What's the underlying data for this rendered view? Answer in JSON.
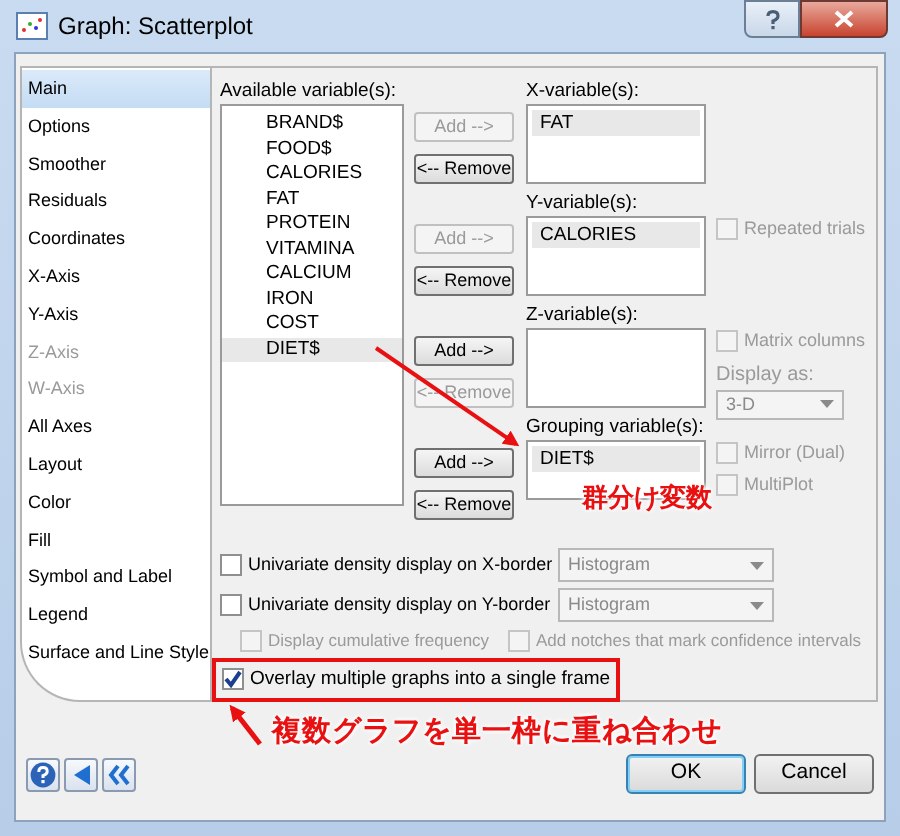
{
  "window": {
    "title": "Graph: Scatterplot"
  },
  "sidebar": {
    "items": [
      {
        "label": "Main",
        "selected": true,
        "disabled": false
      },
      {
        "label": "Options",
        "selected": false,
        "disabled": false
      },
      {
        "label": "Smoother",
        "selected": false,
        "disabled": false
      },
      {
        "label": "Residuals",
        "selected": false,
        "disabled": false
      },
      {
        "label": "Coordinates",
        "selected": false,
        "disabled": false
      },
      {
        "label": "X-Axis",
        "selected": false,
        "disabled": false
      },
      {
        "label": "Y-Axis",
        "selected": false,
        "disabled": false
      },
      {
        "label": "Z-Axis",
        "selected": false,
        "disabled": true
      },
      {
        "label": "W-Axis",
        "selected": false,
        "disabled": true
      },
      {
        "label": "All Axes",
        "selected": false,
        "disabled": false
      },
      {
        "label": "Layout",
        "selected": false,
        "disabled": false
      },
      {
        "label": "Color",
        "selected": false,
        "disabled": false
      },
      {
        "label": "Fill",
        "selected": false,
        "disabled": false
      },
      {
        "label": "Symbol and Label",
        "selected": false,
        "disabled": false
      },
      {
        "label": "Legend",
        "selected": false,
        "disabled": false
      },
      {
        "label": "Surface and Line Style",
        "selected": false,
        "disabled": false
      }
    ]
  },
  "available": {
    "label": "Available variable(s):",
    "items": [
      {
        "label": "BRAND$",
        "selected": false
      },
      {
        "label": "FOOD$",
        "selected": false
      },
      {
        "label": "CALORIES",
        "selected": false
      },
      {
        "label": "FAT",
        "selected": false
      },
      {
        "label": "PROTEIN",
        "selected": false
      },
      {
        "label": "VITAMINA",
        "selected": false
      },
      {
        "label": "CALCIUM",
        "selected": false
      },
      {
        "label": "IRON",
        "selected": false
      },
      {
        "label": "COST",
        "selected": false
      },
      {
        "label": "DIET$",
        "selected": true
      }
    ]
  },
  "variable_groups": [
    {
      "label": "X-variable(s):",
      "values": [
        "FAT"
      ],
      "add_button": {
        "label": "Add -->",
        "disabled": true
      },
      "remove_button": {
        "label": "<-- Remove",
        "disabled": false
      }
    },
    {
      "label": "Y-variable(s):",
      "values": [
        "CALORIES"
      ],
      "add_button": {
        "label": "Add -->",
        "disabled": true
      },
      "remove_button": {
        "label": "<-- Remove",
        "disabled": false
      },
      "options": [
        {
          "kind": "checkbox",
          "label": "Repeated trials",
          "checked": false,
          "disabled": true
        }
      ]
    },
    {
      "label": "Z-variable(s):",
      "add_button": {
        "label": "Add -->",
        "disabled": false
      },
      "remove_button": {
        "label": "<-- Remove",
        "disabled": true
      },
      "options": [
        {
          "kind": "checkbox",
          "label": "Matrix columns",
          "checked": false,
          "disabled": true
        },
        {
          "kind": "caption",
          "label": "Display as:",
          "disabled": true
        },
        {
          "kind": "select",
          "value": "3-D",
          "disabled": true
        }
      ]
    },
    {
      "label": "Grouping variable(s):",
      "values": [
        "DIET$"
      ],
      "add_button": {
        "label": "Add -->",
        "disabled": false
      },
      "remove_button": {
        "label": "<-- Remove",
        "disabled": false
      },
      "options": [
        {
          "kind": "checkbox",
          "label": "Mirror (Dual)",
          "checked": false,
          "disabled": true
        },
        {
          "kind": "checkbox",
          "label": "MultiPlot",
          "checked": false,
          "disabled": true
        }
      ]
    }
  ],
  "density_rows": [
    {
      "label": "Univariate density display on X-border",
      "checked": false,
      "select": {
        "value": "Histogram",
        "disabled": true
      }
    },
    {
      "label": "Univariate density display on Y-border",
      "checked": false,
      "select": {
        "value": "Histogram",
        "disabled": true
      }
    }
  ],
  "sub_options": [
    {
      "label": "Display cumulative frequency",
      "checked": false,
      "disabled": true
    },
    {
      "label": "Add notches that mark confidence intervals",
      "checked": false,
      "disabled": true
    }
  ],
  "overlay": {
    "label": "Overlay multiple graphs into a single frame",
    "checked": true,
    "highlighted": true
  },
  "annotations": [
    {
      "kind": "grouping",
      "text": "群分け変数"
    },
    {
      "kind": "overlay",
      "text": "複数グラフを単一枠に重ね合わせ"
    }
  ],
  "footer": {
    "buttons": [
      {
        "label": "OK",
        "default": true
      },
      {
        "label": "Cancel",
        "default": false
      }
    ]
  }
}
